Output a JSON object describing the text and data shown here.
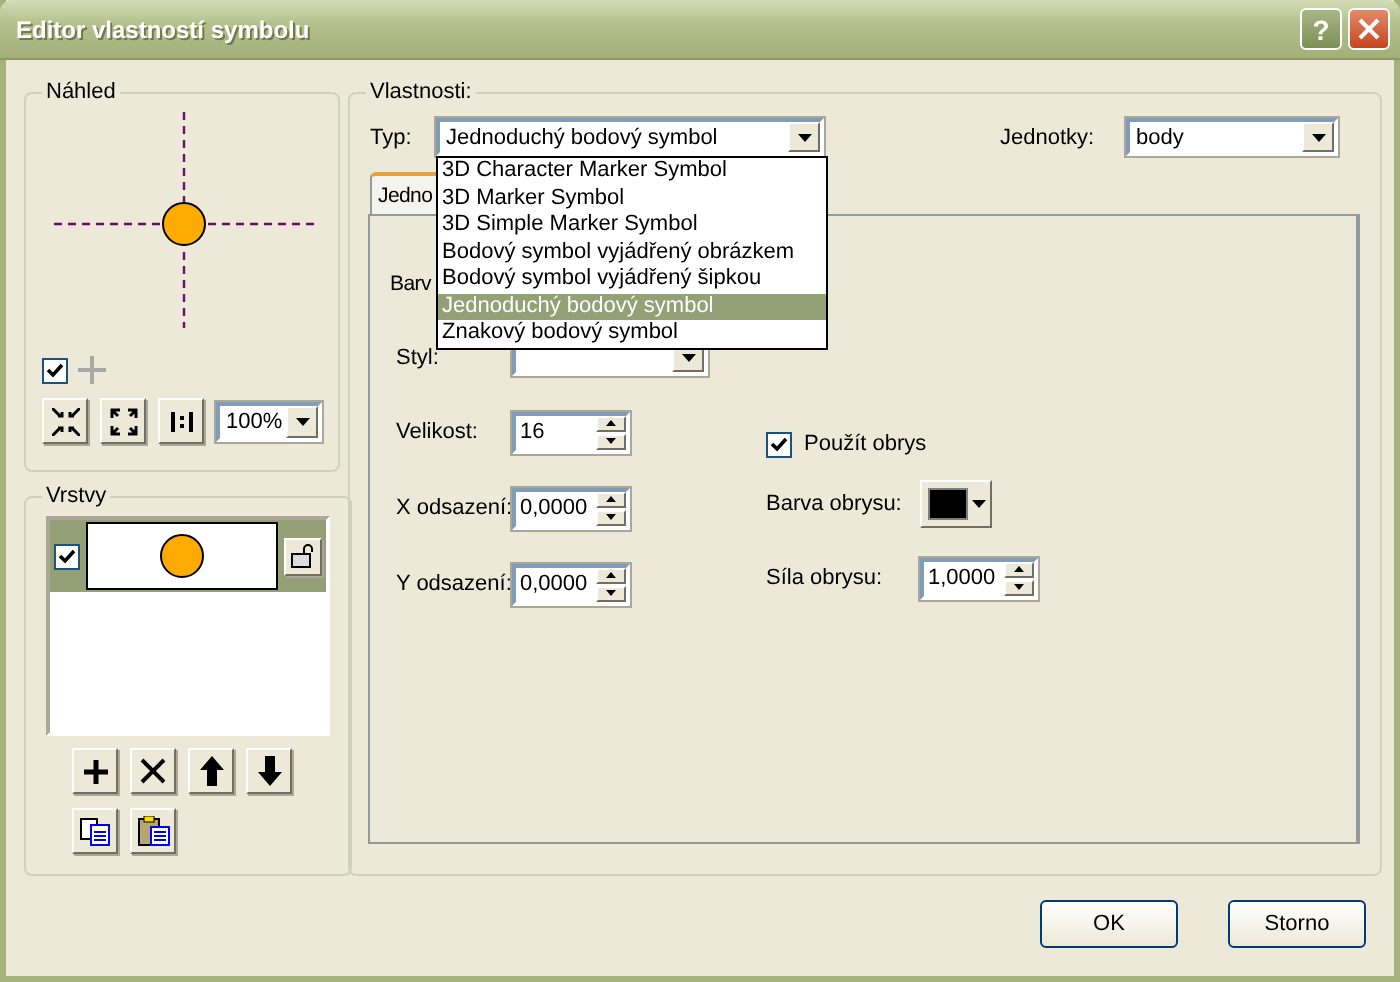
{
  "window": {
    "title": "Editor vlastností symbolu",
    "help": "?"
  },
  "preview": {
    "title": "Náhled",
    "visible_checked": true,
    "zoom": "100%"
  },
  "layers": {
    "title": "Vrstvy",
    "items": [
      {
        "checked": true,
        "selected": true
      }
    ]
  },
  "properties": {
    "title": "Vlastnosti:",
    "type_label": "Typ:",
    "type_value": "Jednoduchý bodový symbol",
    "units_label": "Jednotky:",
    "units_value": "body",
    "type_options": [
      {
        "label": "3D Character Marker Symbol",
        "selected": false
      },
      {
        "label": "3D Marker Symbol",
        "selected": false
      },
      {
        "label": "3D Simple Marker Symbol",
        "selected": false
      },
      {
        "label": "Bodový symbol vyjádřený obrázkem",
        "selected": false
      },
      {
        "label": "Bodový symbol vyjádřený šipkou",
        "selected": false
      },
      {
        "label": "Jednoduchý bodový symbol",
        "selected": true
      },
      {
        "label": "Znakový bodový symbol",
        "selected": false
      }
    ],
    "tab": {
      "label": "Jedno",
      "selected": true
    },
    "left_fields": [
      {
        "kind": "label",
        "label": "Barv"
      },
      {
        "kind": "select",
        "label": "Styl:"
      },
      {
        "kind": "spin",
        "label": "Velikost:",
        "value": "16"
      },
      {
        "kind": "spin",
        "label": "X odsazení:",
        "value": "0,0000"
      },
      {
        "kind": "spin",
        "label": "Y odsazení:",
        "value": "0,0000"
      }
    ],
    "right_fields": [
      {
        "kind": "check",
        "label": "Použít obrys",
        "checked": true
      },
      {
        "kind": "color",
        "label": "Barva obrysu:",
        "color": "#000000"
      },
      {
        "kind": "spin",
        "label": "Síla obrysu:",
        "value": "1,0000"
      }
    ]
  },
  "buttons": [
    "OK",
    "Storno"
  ]
}
